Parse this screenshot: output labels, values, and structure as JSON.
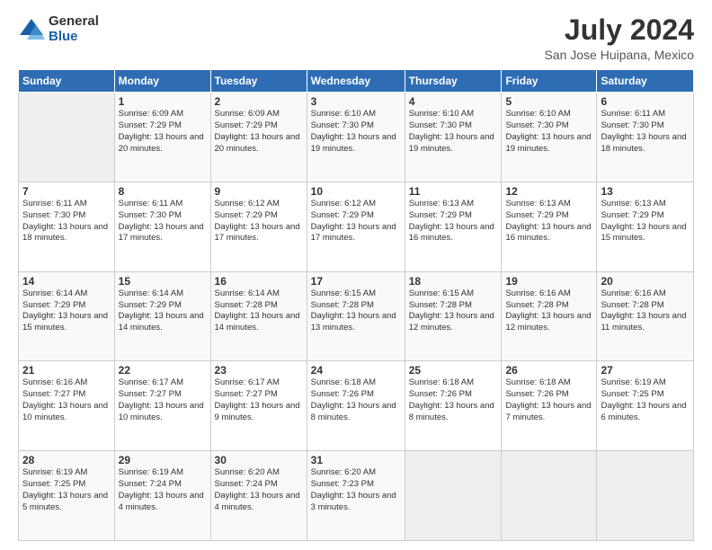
{
  "header": {
    "logo": {
      "line1": "General",
      "line2": "Blue"
    },
    "month_year": "July 2024",
    "location": "San Jose Huipana, Mexico"
  },
  "days_of_week": [
    "Sunday",
    "Monday",
    "Tuesday",
    "Wednesday",
    "Thursday",
    "Friday",
    "Saturday"
  ],
  "weeks": [
    [
      {
        "day": "",
        "sunrise": "",
        "sunset": "",
        "daylight": "",
        "empty": true
      },
      {
        "day": "1",
        "sunrise": "Sunrise: 6:09 AM",
        "sunset": "Sunset: 7:29 PM",
        "daylight": "Daylight: 13 hours and 20 minutes."
      },
      {
        "day": "2",
        "sunrise": "Sunrise: 6:09 AM",
        "sunset": "Sunset: 7:29 PM",
        "daylight": "Daylight: 13 hours and 20 minutes."
      },
      {
        "day": "3",
        "sunrise": "Sunrise: 6:10 AM",
        "sunset": "Sunset: 7:30 PM",
        "daylight": "Daylight: 13 hours and 19 minutes."
      },
      {
        "day": "4",
        "sunrise": "Sunrise: 6:10 AM",
        "sunset": "Sunset: 7:30 PM",
        "daylight": "Daylight: 13 hours and 19 minutes."
      },
      {
        "day": "5",
        "sunrise": "Sunrise: 6:10 AM",
        "sunset": "Sunset: 7:30 PM",
        "daylight": "Daylight: 13 hours and 19 minutes."
      },
      {
        "day": "6",
        "sunrise": "Sunrise: 6:11 AM",
        "sunset": "Sunset: 7:30 PM",
        "daylight": "Daylight: 13 hours and 18 minutes."
      }
    ],
    [
      {
        "day": "7",
        "sunrise": "Sunrise: 6:11 AM",
        "sunset": "Sunset: 7:30 PM",
        "daylight": "Daylight: 13 hours and 18 minutes."
      },
      {
        "day": "8",
        "sunrise": "Sunrise: 6:11 AM",
        "sunset": "Sunset: 7:30 PM",
        "daylight": "Daylight: 13 hours and 17 minutes."
      },
      {
        "day": "9",
        "sunrise": "Sunrise: 6:12 AM",
        "sunset": "Sunset: 7:29 PM",
        "daylight": "Daylight: 13 hours and 17 minutes."
      },
      {
        "day": "10",
        "sunrise": "Sunrise: 6:12 AM",
        "sunset": "Sunset: 7:29 PM",
        "daylight": "Daylight: 13 hours and 17 minutes."
      },
      {
        "day": "11",
        "sunrise": "Sunrise: 6:13 AM",
        "sunset": "Sunset: 7:29 PM",
        "daylight": "Daylight: 13 hours and 16 minutes."
      },
      {
        "day": "12",
        "sunrise": "Sunrise: 6:13 AM",
        "sunset": "Sunset: 7:29 PM",
        "daylight": "Daylight: 13 hours and 16 minutes."
      },
      {
        "day": "13",
        "sunrise": "Sunrise: 6:13 AM",
        "sunset": "Sunset: 7:29 PM",
        "daylight": "Daylight: 13 hours and 15 minutes."
      }
    ],
    [
      {
        "day": "14",
        "sunrise": "Sunrise: 6:14 AM",
        "sunset": "Sunset: 7:29 PM",
        "daylight": "Daylight: 13 hours and 15 minutes."
      },
      {
        "day": "15",
        "sunrise": "Sunrise: 6:14 AM",
        "sunset": "Sunset: 7:29 PM",
        "daylight": "Daylight: 13 hours and 14 minutes."
      },
      {
        "day": "16",
        "sunrise": "Sunrise: 6:14 AM",
        "sunset": "Sunset: 7:28 PM",
        "daylight": "Daylight: 13 hours and 14 minutes."
      },
      {
        "day": "17",
        "sunrise": "Sunrise: 6:15 AM",
        "sunset": "Sunset: 7:28 PM",
        "daylight": "Daylight: 13 hours and 13 minutes."
      },
      {
        "day": "18",
        "sunrise": "Sunrise: 6:15 AM",
        "sunset": "Sunset: 7:28 PM",
        "daylight": "Daylight: 13 hours and 12 minutes."
      },
      {
        "day": "19",
        "sunrise": "Sunrise: 6:16 AM",
        "sunset": "Sunset: 7:28 PM",
        "daylight": "Daylight: 13 hours and 12 minutes."
      },
      {
        "day": "20",
        "sunrise": "Sunrise: 6:16 AM",
        "sunset": "Sunset: 7:28 PM",
        "daylight": "Daylight: 13 hours and 11 minutes."
      }
    ],
    [
      {
        "day": "21",
        "sunrise": "Sunrise: 6:16 AM",
        "sunset": "Sunset: 7:27 PM",
        "daylight": "Daylight: 13 hours and 10 minutes."
      },
      {
        "day": "22",
        "sunrise": "Sunrise: 6:17 AM",
        "sunset": "Sunset: 7:27 PM",
        "daylight": "Daylight: 13 hours and 10 minutes."
      },
      {
        "day": "23",
        "sunrise": "Sunrise: 6:17 AM",
        "sunset": "Sunset: 7:27 PM",
        "daylight": "Daylight: 13 hours and 9 minutes."
      },
      {
        "day": "24",
        "sunrise": "Sunrise: 6:18 AM",
        "sunset": "Sunset: 7:26 PM",
        "daylight": "Daylight: 13 hours and 8 minutes."
      },
      {
        "day": "25",
        "sunrise": "Sunrise: 6:18 AM",
        "sunset": "Sunset: 7:26 PM",
        "daylight": "Daylight: 13 hours and 8 minutes."
      },
      {
        "day": "26",
        "sunrise": "Sunrise: 6:18 AM",
        "sunset": "Sunset: 7:26 PM",
        "daylight": "Daylight: 13 hours and 7 minutes."
      },
      {
        "day": "27",
        "sunrise": "Sunrise: 6:19 AM",
        "sunset": "Sunset: 7:25 PM",
        "daylight": "Daylight: 13 hours and 6 minutes."
      }
    ],
    [
      {
        "day": "28",
        "sunrise": "Sunrise: 6:19 AM",
        "sunset": "Sunset: 7:25 PM",
        "daylight": "Daylight: 13 hours and 5 minutes."
      },
      {
        "day": "29",
        "sunrise": "Sunrise: 6:19 AM",
        "sunset": "Sunset: 7:24 PM",
        "daylight": "Daylight: 13 hours and 4 minutes."
      },
      {
        "day": "30",
        "sunrise": "Sunrise: 6:20 AM",
        "sunset": "Sunset: 7:24 PM",
        "daylight": "Daylight: 13 hours and 4 minutes."
      },
      {
        "day": "31",
        "sunrise": "Sunrise: 6:20 AM",
        "sunset": "Sunset: 7:23 PM",
        "daylight": "Daylight: 13 hours and 3 minutes."
      },
      {
        "day": "",
        "sunrise": "",
        "sunset": "",
        "daylight": "",
        "empty": true
      },
      {
        "day": "",
        "sunrise": "",
        "sunset": "",
        "daylight": "",
        "empty": true
      },
      {
        "day": "",
        "sunrise": "",
        "sunset": "",
        "daylight": "",
        "empty": true
      }
    ]
  ]
}
